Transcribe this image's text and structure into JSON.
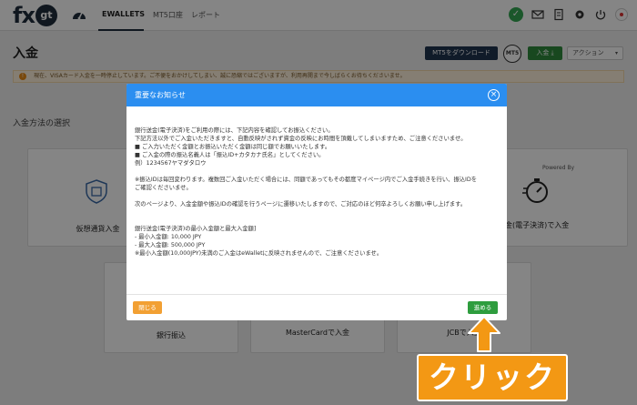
{
  "nav": {
    "logo_text": "fx",
    "logo_badge": "gt",
    "tabs": [
      "EWALLETS",
      "MT5口座",
      "レポート"
    ]
  },
  "header": {
    "title": "入金",
    "mt5_download": "MT5をダウンロード",
    "mt5_badge": "MT5",
    "deposit_button": "入金 ⤓",
    "action_button": "アクション"
  },
  "notice": "現在、VISAカード入金を一時停止しています。ご不便をおかけしてしまい、誠に恐縮ではございますが、利用再開まで今しばらくお待ちくださいませ。",
  "section_label": "入金方法の選択",
  "cards": {
    "crypto": "仮想通貨入金",
    "bank_electronic": "銀行送金(電子決済)で入金",
    "powered_by": "Powered By",
    "bank_transfer": "銀行振込",
    "mastercard": "MasterCardで入金",
    "jcb": "JCBで入金"
  },
  "modal": {
    "title": "重要なお知らせ",
    "lines": [
      "銀行送金(電子決済)をご利用の際には、下記内容を確認してお振込ください。",
      "下記方法以外でご入金いただきますと、自動反映がされず資金の反映にお時間を頂戴してしまいますため、ご注意くださいませ。",
      "■ ご入力いただく金額とお振込いただく金額は同じ額でお願いいたします。",
      "■ ご入金の際の振込名義人は「振込ID+カタカナ氏名」としてください。",
      "例）1234567ヤマダタロウ",
      "",
      "※振込IDは毎回変わります。複数回ご入金いただく場合には、同額であってもその都度マイページ内でご入金手続きを行い、振込IDを",
      "ご確認くださいませ。",
      "",
      "次のページより、入金金額や振込IDの確認を行うページに遷移いたしますので、ご対応のほど何卒よろしくお願い申し上げます。",
      "",
      "",
      "銀行送金(電子決済)の最小入金額と最大入金額]",
      "- 最小入金額: 10,000 JPY",
      "- 最大入金額: 500,000 JPY",
      "※最小入金額(10,000JPY)未満のご入金はeWalletに反映されませんので、ご注意くださいませ。"
    ],
    "close_button": "閉じる",
    "next_button": "進める"
  },
  "annotation": {
    "callout": "クリック",
    "color": "#f39814"
  }
}
